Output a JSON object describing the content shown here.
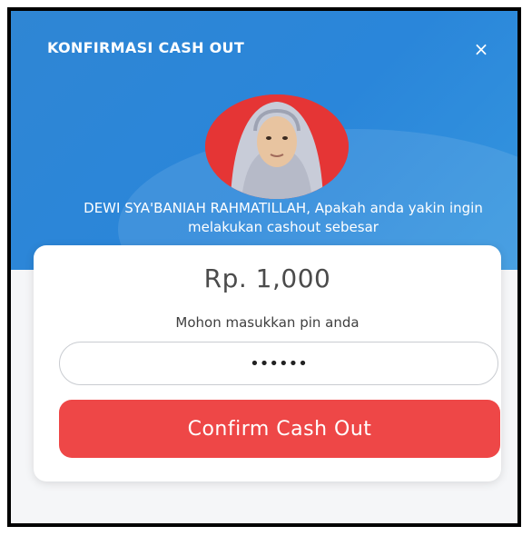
{
  "dialog": {
    "title": "KONFIRMASI CASH OUT",
    "close_glyph": "×",
    "message": "DEWI SYA'BANIAH RAHMATILLAH, Apakah anda yakin ingin melakukan cashout sebesar",
    "amount": "Rp. 1,000",
    "pin_label": "Mohon masukkan pin anda",
    "pin_value": "••••••",
    "confirm_label": "Confirm Cash Out"
  },
  "colors": {
    "header": "#2a86da",
    "confirm": "#ee4747",
    "avatar_bg": "#e53535"
  },
  "icons": {
    "close": "close-icon",
    "avatar": "user-photo"
  }
}
